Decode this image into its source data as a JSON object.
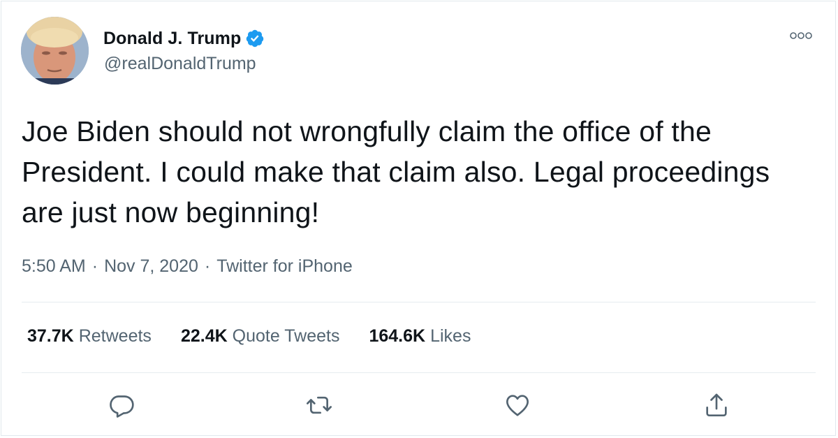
{
  "author": {
    "display_name": "Donald J. Trump",
    "handle": "@realDonaldTrump",
    "verified": true,
    "avatar_icon": "profile-photo"
  },
  "tweet": {
    "text": "Joe Biden should not wrongfully claim the office of the President. I could make that claim also. Legal proceedings are just now beginning!",
    "time": "5:50 AM",
    "date": "Nov 7, 2020",
    "source": "Twitter for iPhone",
    "separator": "·"
  },
  "stats": {
    "retweets": {
      "count": "37.7K",
      "label": "Retweets"
    },
    "quote_tweets": {
      "count": "22.4K",
      "label": "Quote Tweets"
    },
    "likes": {
      "count": "164.6K",
      "label": "Likes"
    }
  },
  "actions": [
    {
      "name": "reply",
      "icon": "comment-icon"
    },
    {
      "name": "retweet",
      "icon": "retweet-icon"
    },
    {
      "name": "like",
      "icon": "heart-icon"
    },
    {
      "name": "share",
      "icon": "share-icon"
    }
  ],
  "colors": {
    "text_primary": "#0f1419",
    "text_secondary": "#536471",
    "verified_blue": "#1d9bf0",
    "divider": "#e6ecf0"
  }
}
